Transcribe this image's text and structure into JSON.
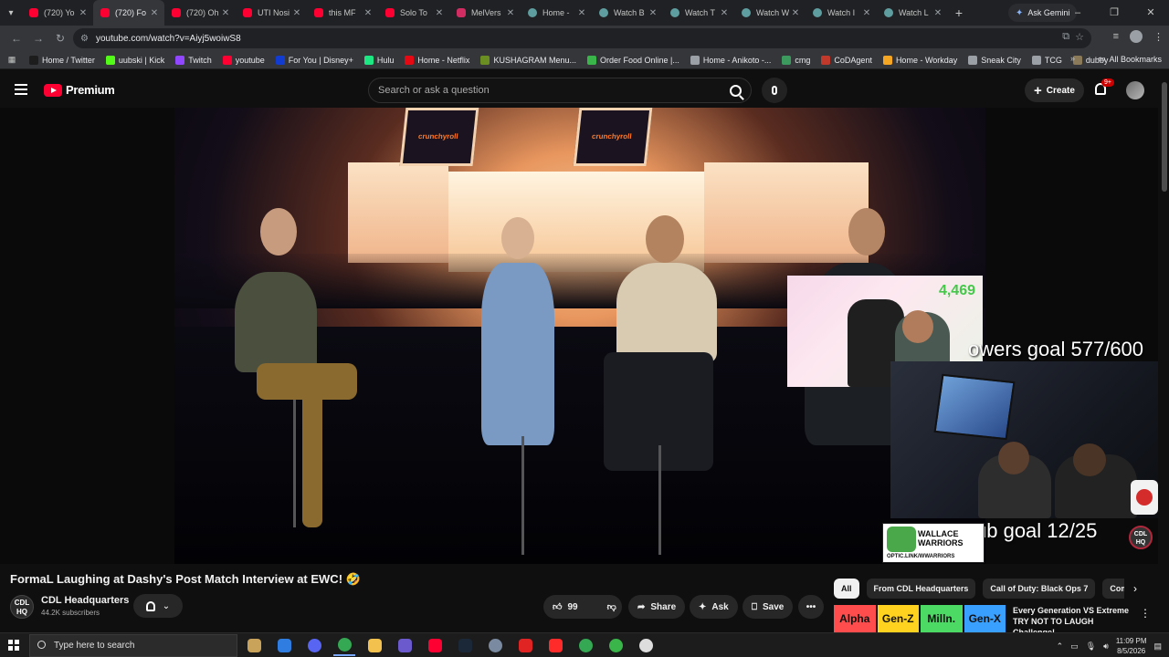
{
  "browser": {
    "tabs": [
      {
        "title": "(720) Yo",
        "favicon": "youtube-icon",
        "active": false
      },
      {
        "title": "(720) Fo",
        "favicon": "youtube-icon",
        "active": true
      },
      {
        "title": "(720) Oh",
        "favicon": "youtube-icon",
        "active": false
      },
      {
        "title": "UTI Nosi",
        "favicon": "youtube-icon",
        "active": false
      },
      {
        "title": "this MF",
        "favicon": "youtube-icon",
        "active": false
      },
      {
        "title": "Solo To",
        "favicon": "youtube-icon",
        "active": false
      },
      {
        "title": "MelVers",
        "favicon": "m-icon",
        "active": false
      },
      {
        "title": "Home -",
        "favicon": "web-icon",
        "active": false
      },
      {
        "title": "Watch B",
        "favicon": "web-icon",
        "active": false
      },
      {
        "title": "Watch T",
        "favicon": "web-icon",
        "active": false
      },
      {
        "title": "Watch W",
        "favicon": "web-icon",
        "active": false
      },
      {
        "title": "Watch I",
        "favicon": "web-icon",
        "active": false
      },
      {
        "title": "Watch L",
        "favicon": "web-icon",
        "active": false
      }
    ],
    "gemini_label": "Ask Gemini",
    "url": "youtube.com/watch?v=Aiyj5woiwS8",
    "bookmarks": [
      {
        "label": "Home / Twitter",
        "color": "#1d1d1d",
        "icon": "x-icon"
      },
      {
        "label": "uubski | Kick",
        "color": "#53fc18",
        "icon": "kick-icon"
      },
      {
        "label": "Twitch",
        "color": "#9146ff",
        "icon": "twitch-icon"
      },
      {
        "label": "youtube",
        "color": "#ff0033",
        "icon": "youtube-icon"
      },
      {
        "label": "For You | Disney+",
        "color": "#113ccf",
        "icon": "disney-icon"
      },
      {
        "label": "Hulu",
        "color": "#1ce783",
        "icon": "hulu-icon"
      },
      {
        "label": "Home - Netflix",
        "color": "#e50914",
        "icon": "netflix-icon"
      },
      {
        "label": "KUSHAGRAM Menu...",
        "color": "#6b8e23",
        "icon": "leaf-icon"
      },
      {
        "label": "Order Food Online |...",
        "color": "#3ab54a",
        "icon": "food-icon"
      },
      {
        "label": "Home - Anikoto -...",
        "color": "#9aa0a6",
        "icon": "globe-icon"
      },
      {
        "label": "cmg",
        "color": "#3c9a5f",
        "icon": "diamond-icon"
      },
      {
        "label": "CoDAgent",
        "color": "#c0392b",
        "icon": "shield-icon"
      },
      {
        "label": "Home - Workday",
        "color": "#f5a623",
        "icon": "workday-icon"
      },
      {
        "label": "Sneak City",
        "color": "#9aa0a6",
        "icon": "globe-icon"
      },
      {
        "label": "TCG",
        "color": "#9aa0a6",
        "icon": "globe-icon"
      },
      {
        "label": "dubby",
        "color": "#8a7a5a",
        "icon": "dubby-icon"
      }
    ],
    "all_bookmarks_label": "All Bookmarks"
  },
  "youtube": {
    "brand": "Premium",
    "search_placeholder": "Search or ask a question",
    "create_label": "Create",
    "notification_count": "9+",
    "video": {
      "title": "FormaL Laughing at Dashy's Post Match Interview at EWC! 🤣",
      "stream_overlay": {
        "viewer_count": "4,469",
        "followers_goal": "owers goal 577/600",
        "sub_goal": "ub goal 12/25",
        "sponsor_name": "WALLACE WARRIORS",
        "sponsor_link": "OPTIC.LINK/WWARRIORS",
        "crunchyroll_label": "crunchyroll",
        "cdl_badge": "CDL HQ"
      }
    },
    "channel": {
      "name": "CDL Headquarters",
      "subscribers": "44.2K subscribers",
      "avatar_text": "CDL HQ"
    },
    "actions": {
      "like_count": "99",
      "share_label": "Share",
      "ask_label": "Ask",
      "save_label": "Save"
    },
    "chips": [
      "All",
      "From CDL Headquarters",
      "Call of Duty: Black Ops 7",
      "Comedy"
    ],
    "recommendation": {
      "title": "Every Generation VS Extreme TRY NOT TO LAUGH Challenge!",
      "thumb_segments": [
        {
          "label": "Alpha",
          "color": "#ff4d4d"
        },
        {
          "label": "Gen-Z",
          "color": "#ffd21f"
        },
        {
          "label": "Milln.",
          "color": "#4cd964"
        },
        {
          "label": "Gen-X",
          "color": "#3aa0ff"
        }
      ]
    }
  },
  "taskbar": {
    "search_placeholder": "Type here to search",
    "time": "11:09 PM",
    "date": "8/5/2026",
    "apps": [
      {
        "name": "file-explorer-thumb-icon",
        "color": "#c9a35a"
      },
      {
        "name": "app-blue-icon",
        "color": "#2f7de1"
      },
      {
        "name": "discord-icon",
        "color": "#5865f2"
      },
      {
        "name": "chrome-icon",
        "color": "#34a853"
      },
      {
        "name": "folder-icon",
        "color": "#f2c14e"
      },
      {
        "name": "controller-icon",
        "color": "#6a5acd"
      },
      {
        "name": "youtube-music-icon",
        "color": "#ff0033"
      },
      {
        "name": "steam-icon",
        "color": "#1b2838"
      },
      {
        "name": "app-circle-icon",
        "color": "#7a8aa0"
      },
      {
        "name": "app-red-icon",
        "color": "#e02424"
      },
      {
        "name": "adobe-icon",
        "color": "#ff2a2a"
      },
      {
        "name": "chrome-alt-icon",
        "color": "#34a853"
      },
      {
        "name": "chrome-alt2-icon",
        "color": "#3ab54a"
      },
      {
        "name": "clock-app-icon",
        "color": "#dddddd"
      }
    ]
  }
}
